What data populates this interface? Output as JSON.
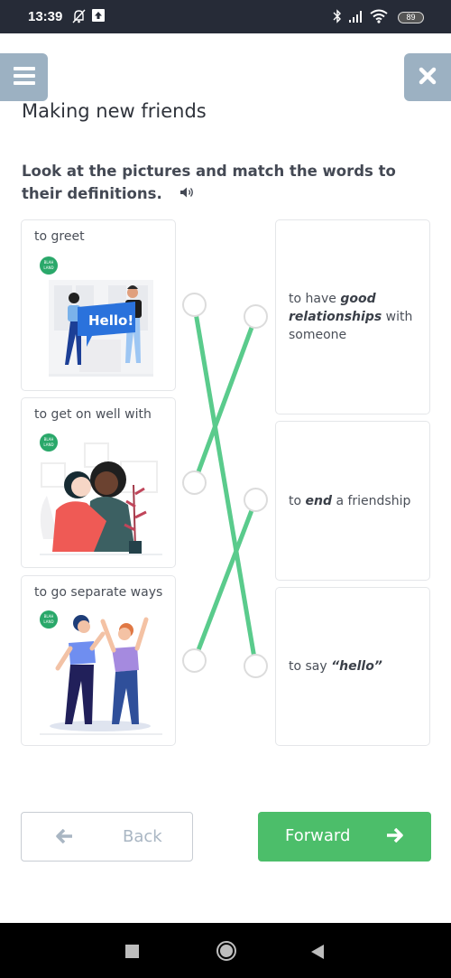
{
  "status_bar": {
    "time": "13:39",
    "icons": [
      "mute-notification-icon",
      "upload-icon",
      "bluetooth-icon",
      "signal-icon",
      "wifi-icon"
    ],
    "battery": "89"
  },
  "header": {
    "menu_icon": "hamburger-menu-icon",
    "close_icon": "close-icon",
    "title": "Making new friends"
  },
  "exercise": {
    "instruction": "Look at the pictures and match the words to their definitions.",
    "audio_icon": "speaker-icon",
    "accent_color": "#5acb8c",
    "words": [
      {
        "label": "to greet",
        "picture": "two people holding a Hello! speech bubble sign",
        "sign_text": "Hello!"
      },
      {
        "label": "to get on well with",
        "picture": "two women hugging"
      },
      {
        "label": "to go separate ways",
        "picture": "two men shouting at each other"
      }
    ],
    "definitions": [
      {
        "pre": "to have ",
        "bold": "good relationships",
        "post": " with someone"
      },
      {
        "pre": "to ",
        "bold": "end",
        "post": " a friendship"
      },
      {
        "pre": "to say ",
        "bold": "“hello”",
        "post": ""
      }
    ],
    "matches": [
      {
        "word": 0,
        "definition": 2
      },
      {
        "word": 1,
        "definition": 0
      },
      {
        "word": 2,
        "definition": 1
      }
    ]
  },
  "footer": {
    "back_label": "Back",
    "forward_label": "Forward",
    "forward_color": "#4cbe6a"
  },
  "nav_bar": {
    "buttons": [
      "recents-button",
      "home-button",
      "back-button"
    ]
  }
}
